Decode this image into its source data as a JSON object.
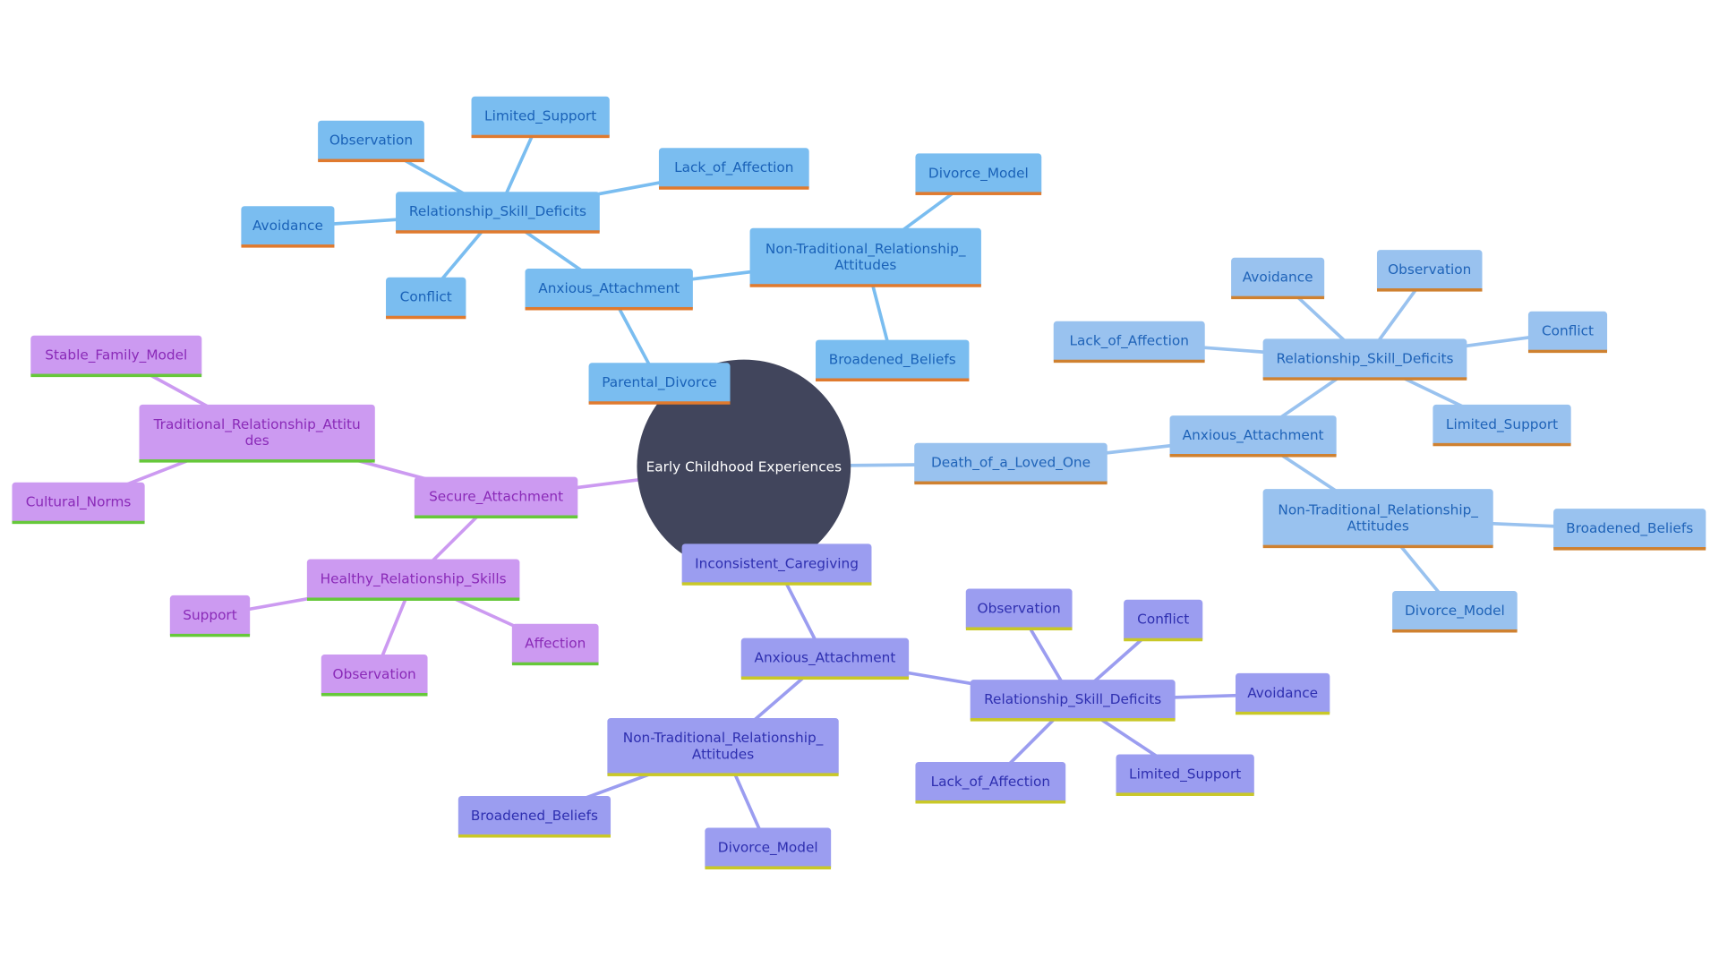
{
  "root": {
    "label": "Early Childhood Experiences",
    "color": "#41455c"
  },
  "colors": {
    "blue_branch": "#7abdf0",
    "light_blue_branch": "#99c2ef",
    "purple_branch": "#cc9af1",
    "indigo_branch": "#9b9df0"
  },
  "parental_divorce": {
    "label": "Parental_Divorce",
    "anxious": "Anxious_Attachment",
    "rsd": "Relationship_Skill_Deficits",
    "observation": "Observation",
    "limited_support": "Limited_Support",
    "lack_of_affection": "Lack_of_Affection",
    "avoidance": "Avoidance",
    "conflict": "Conflict",
    "nontrad": "Non-Traditional_Relationship_ Attitudes",
    "divorce_model": "Divorce_Model",
    "broadened": "Broadened_Beliefs"
  },
  "death": {
    "label": "Death_of_a_Loved_One",
    "anxious": "Anxious_Attachment",
    "rsd": "Relationship_Skill_Deficits",
    "avoidance": "Avoidance",
    "observation": "Observation",
    "conflict": "Conflict",
    "lack_of_affection": "Lack_of_Affection",
    "limited_support": "Limited_Support",
    "nontrad": "Non-Traditional_Relationship_ Attitudes",
    "broadened": "Broadened_Beliefs",
    "divorce_model": "Divorce_Model"
  },
  "secure": {
    "label": "Secure_Attachment",
    "traditional": "Traditional_Relationship_Attitu des",
    "stable": "Stable_Family_Model",
    "cultural": "Cultural_Norms",
    "healthy": "Healthy_Relationship_Skills",
    "support": "Support",
    "affection": "Affection",
    "observation": "Observation"
  },
  "inconsistent": {
    "label": "Inconsistent_Caregiving",
    "anxious": "Anxious_Attachment",
    "rsd": "Relationship_Skill_Deficits",
    "observation": "Observation",
    "conflict": "Conflict",
    "avoidance": "Avoidance",
    "limited_support": "Limited_Support",
    "lack_of_affection": "Lack_of_Affection",
    "nontrad": "Non-Traditional_Relationship_ Attitudes",
    "broadened": "Broadened_Beliefs",
    "divorce_model": "Divorce_Model"
  }
}
